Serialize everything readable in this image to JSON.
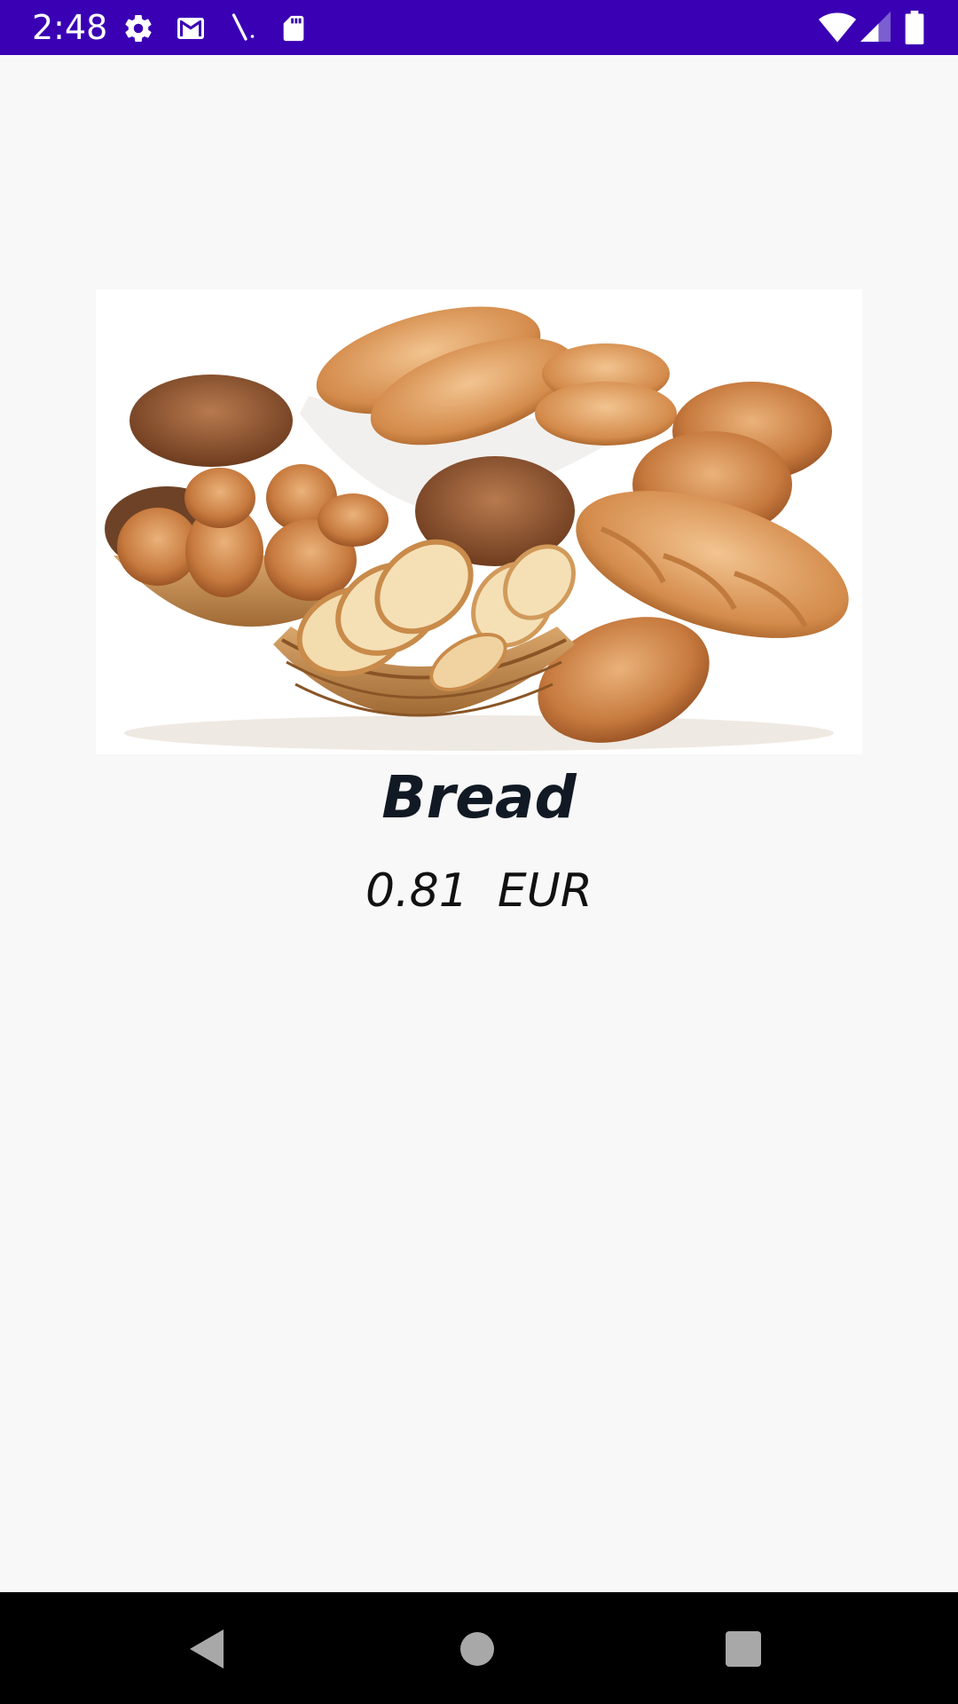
{
  "status_bar": {
    "time": "2:48",
    "background": "#3a00b4",
    "left_icons": [
      "settings-gear-icon",
      "gmail-icon",
      "pen-tool-icon",
      "sd-card-icon"
    ],
    "right_icons": [
      "wifi-icon",
      "cell-signal-icon",
      "battery-icon"
    ]
  },
  "product": {
    "image": "bread-assortment-photo",
    "name": "Bread",
    "price_value": "0.81",
    "currency": "EUR"
  },
  "nav_bar": {
    "buttons": [
      "back-icon",
      "home-icon",
      "recents-icon"
    ]
  }
}
